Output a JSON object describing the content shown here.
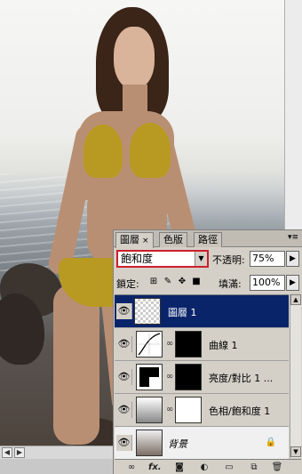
{
  "panel": {
    "tabs": [
      {
        "label": "圖層",
        "close": "×"
      },
      {
        "label": "色版"
      },
      {
        "label": "路徑"
      }
    ],
    "menu_icon": "panel-menu-icon",
    "blend_mode": "飽和度",
    "opacity_label": "不透明:",
    "opacity_value": "75%",
    "lock_label": "鎖定:",
    "fill_label": "填滿:",
    "fill_value": "100%",
    "layers": [
      {
        "name": "圖層 1",
        "selected": true
      },
      {
        "name": "曲線 1"
      },
      {
        "name": "亮度/對比 1 ..."
      },
      {
        "name": "色相/飽和度 1"
      },
      {
        "name": "背景"
      }
    ],
    "bottom_icons": [
      "link-icon",
      "fx-icon",
      "add-mask-icon",
      "adjustment-layer-icon",
      "new-group-icon",
      "new-layer-icon",
      "trash-icon"
    ],
    "fx_label": "fx."
  },
  "colors": {
    "selection": "#0a246a",
    "panel_bg": "#d4d0c8",
    "blend_highlight": "#cc1f2b"
  }
}
